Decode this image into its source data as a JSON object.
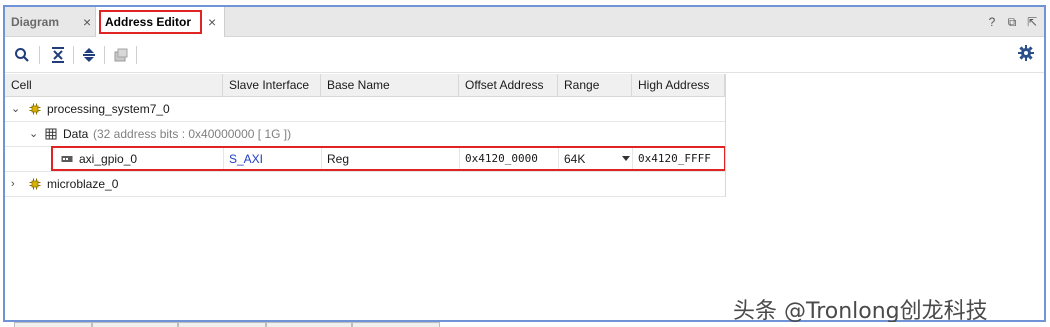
{
  "tabs": [
    {
      "label": "Diagram",
      "active": false
    },
    {
      "label": "Address Editor",
      "active": true
    }
  ],
  "window_controls": {
    "help": "?",
    "restore": "⧉",
    "float": "⇱"
  },
  "toolbar": {
    "buttons": [
      "search-icon",
      "collapse-all-icon",
      "expand-all-icon",
      "auto-assign-icon"
    ],
    "settings_icon": "gear-icon"
  },
  "table": {
    "columns": [
      "Cell",
      "Slave Interface",
      "Base Name",
      "Offset Address",
      "Range",
      "High Address"
    ],
    "rows": [
      {
        "level": 0,
        "expanded": true,
        "icon": "processor-icon",
        "cell": "processing_system7_0",
        "slave_interface": "",
        "base_name": "",
        "offset": "",
        "range": "",
        "high": ""
      },
      {
        "level": 1,
        "expanded": true,
        "icon": "address-space-icon",
        "cell": "Data",
        "cell_note": "(32 address bits : 0x40000000 [ 1G ])",
        "slave_interface": "",
        "base_name": "",
        "offset": "",
        "range": "",
        "high": ""
      },
      {
        "level": 2,
        "icon": "peripheral-icon",
        "cell": "axi_gpio_0",
        "slave_interface": "S_AXI",
        "base_name": "Reg",
        "offset": "0x4120_0000",
        "range": "64K",
        "high": "0x4120_FFFF",
        "highlighted": true
      },
      {
        "level": 0,
        "expanded": false,
        "icon": "processor-icon",
        "cell": "microblaze_0",
        "slave_interface": "",
        "base_name": "",
        "offset": "",
        "range": "",
        "high": ""
      }
    ]
  },
  "watermark": "头条 @Tronlong创龙科技",
  "colors": {
    "highlight_border": "#e02424",
    "frame_border": "#6f93d6",
    "link": "#1f3ec2"
  }
}
